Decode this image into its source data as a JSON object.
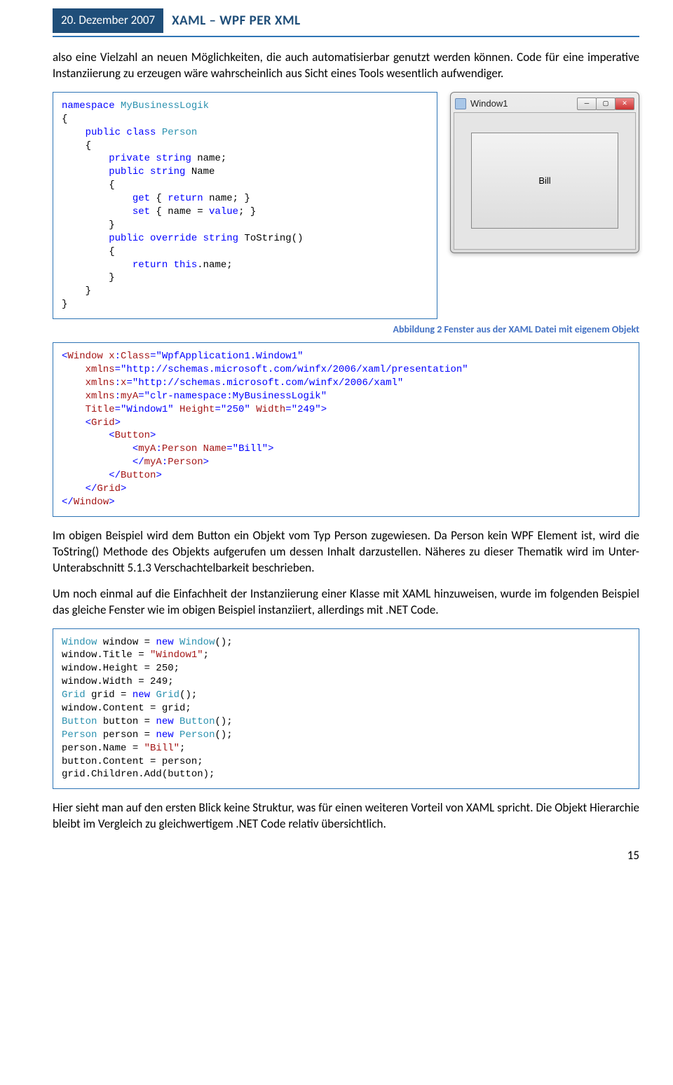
{
  "header": {
    "date": "20. Dezember 2007",
    "title": "XAML – WPF PER XML"
  },
  "para1": "also eine Vielzahl an neuen Möglichkeiten, die auch automatisierbar genutzt werden können. Code für eine imperative Instanziierung zu erzeugen wäre wahrscheinlich aus Sicht eines Tools wesentlich aufwendiger.",
  "code1": {
    "l1a": "namespace",
    "l1b": " MyBusinessLogik",
    "l2": "{",
    "l3a": "    public",
    "l3b": " class",
    "l3c": " Person",
    "l4": "    {",
    "l5a": "        private",
    "l5b": " string",
    "l5c": " name;",
    "l6a": "        public",
    "l6b": " string",
    "l6c": " Name",
    "l7": "        {",
    "l8a": "            get",
    "l8b": " { ",
    "l8c": "return",
    "l8d": " name; }",
    "l9a": "            set",
    "l9b": " { name = ",
    "l9c": "value",
    "l9d": "; }",
    "l10": "        }",
    "l11a": "        public",
    "l11b": " override",
    "l11c": " string",
    "l11d": " ToString()",
    "l12": "        {",
    "l13a": "            return",
    "l13b": " this",
    "l13c": ".name;",
    "l14": "        }",
    "l15": "    }",
    "l16": "}"
  },
  "window_mock": {
    "title": "Window1",
    "button_text": "Bill"
  },
  "caption": "Abbildung 2 Fenster aus der XAML Datei mit eigenem Objekt",
  "code2": {
    "l1a": "<",
    "l1b": "Window",
    "l1c": " x",
    "l1d": ":",
    "l1e": "Class",
    "l1f": "=\"WpfApplication1.Window1\"",
    "l2a": "    xmlns",
    "l2b": "=\"http://schemas.microsoft.com/winfx/2006/xaml/presentation\"",
    "l3a": "    xmlns",
    "l3b": ":",
    "l3c": "x",
    "l3d": "=\"http://schemas.microsoft.com/winfx/2006/xaml\"",
    "l4a": "    xmlns",
    "l4b": ":",
    "l4c": "myA",
    "l4d": "=\"clr-namespace:MyBusinessLogik\"",
    "l5a": "    Title",
    "l5b": "=\"Window1\"",
    "l5c": " Height",
    "l5d": "=\"250\"",
    "l5e": " Width",
    "l5f": "=\"249\">",
    "l6a": "    <",
    "l6b": "Grid",
    "l6c": ">",
    "l7a": "        <",
    "l7b": "Button",
    "l7c": ">",
    "l8a": "            <",
    "l8b": "myA",
    "l8c": ":",
    "l8d": "Person",
    "l8e": " Name",
    "l8f": "=\"Bill\">",
    "l9a": "            </",
    "l9b": "myA",
    "l9c": ":",
    "l9d": "Person",
    "l9e": ">",
    "l10a": "        </",
    "l10b": "Button",
    "l10c": ">",
    "l11a": "    </",
    "l11b": "Grid",
    "l11c": ">",
    "l12a": "</",
    "l12b": "Window",
    "l12c": ">"
  },
  "para2": "Im obigen Beispiel wird dem Button ein Objekt vom Typ Person zugewiesen. Da Person kein WPF Element ist, wird die ToString() Methode des Objekts aufgerufen um dessen Inhalt darzustellen. Näheres zu dieser Thematik wird im Unter-Unterabschnitt 5.1.3 Verschachtelbarkeit beschrieben.",
  "para3": "Um noch einmal auf die Einfachheit der Instanziierung einer Klasse mit XAML hinzuweisen, wurde im folgenden Beispiel das gleiche Fenster wie im obigen Beispiel instanziiert, allerdings mit .NET Code.",
  "code3": {
    "l1a": "Window",
    "l1b": " window = ",
    "l1c": "new",
    "l1d": " Window",
    "l1e": "();",
    "l2a": "window.Title = ",
    "l2b": "\"Window1\"",
    "l2c": ";",
    "l3": "window.Height = 250;",
    "l4": "window.Width = 249;",
    "l5a": "Grid",
    "l5b": " grid = ",
    "l5c": "new",
    "l5d": " Grid",
    "l5e": "();",
    "l6": "window.Content = grid;",
    "l7a": "Button",
    "l7b": " button = ",
    "l7c": "new",
    "l7d": " Button",
    "l7e": "();",
    "l8a": "Person",
    "l8b": " person = ",
    "l8c": "new",
    "l8d": " Person",
    "l8e": "();",
    "l9a": "person.Name = ",
    "l9b": "\"Bill\"",
    "l9c": ";",
    "l10": "button.Content = person;",
    "l11": "grid.Children.Add(button);"
  },
  "para4": "Hier sieht man auf den ersten Blick keine Struktur, was für einen weiteren Vorteil von XAML spricht. Die Objekt Hierarchie bleibt im Vergleich zu gleichwertigem .NET Code relativ übersichtlich.",
  "page_num": "15"
}
